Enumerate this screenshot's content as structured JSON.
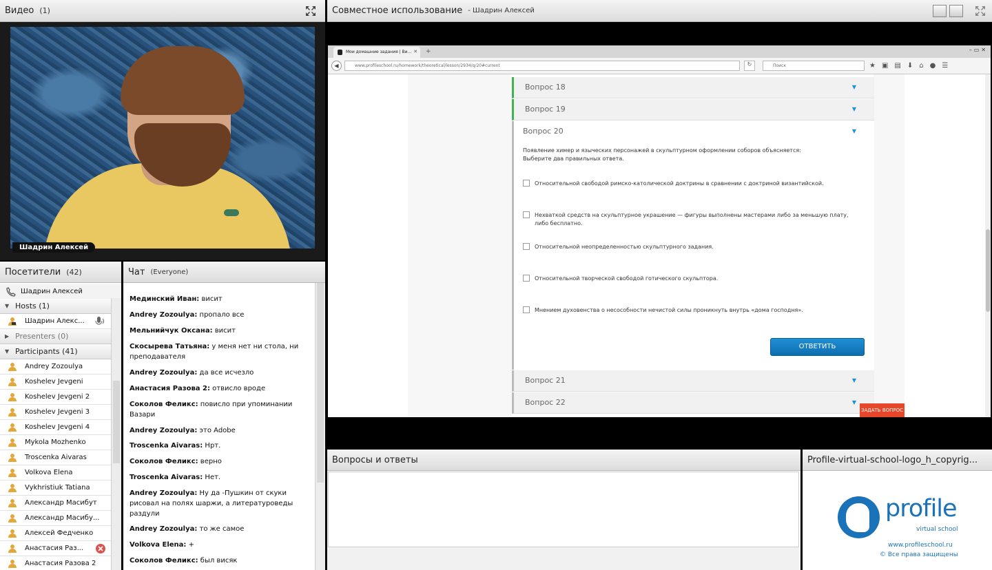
{
  "video": {
    "title": "Видео",
    "count": "(1)",
    "presenter_name": "Шадрин Алексей"
  },
  "share": {
    "title": "Совместное использование",
    "presenter": "- Шадрин Алексей",
    "browser": {
      "tab_title": "Мои домашние задания | Ви...",
      "tab_close": "✕",
      "new_tab": "+",
      "url": "www.profileschool.ru/homework/theoretical/lesson/2934/q/20#current",
      "search_placeholder": "Поиск"
    },
    "page": {
      "questions_before": [
        {
          "label": "Вопрос 18",
          "arrow": "▼"
        },
        {
          "label": "Вопрос 19",
          "arrow": "▼"
        }
      ],
      "open_question": {
        "label": "Вопрос 20",
        "arrow": "▼",
        "text_line1": "Появление химер и языческих персонажей в скульптурном оформлении соборов объясняется:",
        "text_line2": "Выберите два правильных ответа.",
        "options": [
          "Относительной свободой римско-католической доктрины в сравнении с доктриной византийской.",
          "Нехваткой средств на скульптурное украшение — фигуры выполнены мастерами либо за меньшую плату, либо бесплатно.",
          "Относительной неопределенностью скульптурного задания.",
          "Относительной творческой свободой готического скульптора.",
          "Мнением духовенства о несособности нечистой силы проникнуть внутрь «дома господня»."
        ],
        "answer_button": "ОТВЕТИТЬ"
      },
      "questions_after": [
        {
          "label": "Вопрос 21",
          "arrow": "▼"
        },
        {
          "label": "Вопрос 22",
          "arrow": "▼"
        }
      ],
      "ask_button": "ЗАДАТЬ ВОПРОС"
    }
  },
  "attendees": {
    "title": "Посетители",
    "count": "(42)",
    "me": "Шадрин Алексей",
    "hosts_label": "Hosts (1)",
    "host_name": "Шадрин Алекс...",
    "presenters_label": "Presenters (0)",
    "participants_label": "Participants (41)",
    "participants": [
      "Andrey Zozoulya",
      "Koshelev Jevgeni",
      "Koshelev Jevgeni 2",
      "Koshelev Jevgeni 3",
      "Koshelev Jevgeni 4",
      "Mykola Mozhenko",
      "Troscenka Aivaras",
      "Volkova Elena",
      "Vykhristiuk Tatiana",
      "Александр Масибут",
      "Александр Масибу...",
      "Алексей Федченко",
      "Анастасия Раз...",
      "Анастасия Разова 2"
    ]
  },
  "chat": {
    "title": "Чат",
    "audience": "(Everyone)",
    "messages": [
      {
        "author": "Мединский Иван:",
        "text": " висит"
      },
      {
        "author": "Andrey Zozoulya:",
        "text": " пропало все"
      },
      {
        "author": "Мельнийчук Оксана:",
        "text": " висит"
      },
      {
        "author": "Скосырева Татьяна:",
        "text": " у меня нет ни стола, ни преподавателя"
      },
      {
        "author": "Andrey Zozoulya:",
        "text": " да все исчезло"
      },
      {
        "author": "Анастасия Разова 2:",
        "text": " отвисло вроде"
      },
      {
        "author": "Соколов Феликс:",
        "text": " повисло при упоминании Вазари"
      },
      {
        "author": "Andrey Zozoulya:",
        "text": " это Adobe"
      },
      {
        "author": "Troscenka Aivaras:",
        "text": " Нрт."
      },
      {
        "author": "Соколов Феликс:",
        "text": " верно"
      },
      {
        "author": "Troscenka Aivaras:",
        "text": " Нет."
      },
      {
        "author": "Andrey Zozoulya:",
        "text": " Ну да -Пушкин от скуки рисовал на полях шаржи, а литературоведы раздули"
      },
      {
        "author": "Andrey Zozoulya:",
        "text": " то же самое"
      },
      {
        "author": "Volkova Elena:",
        "text": " +"
      },
      {
        "author": "Соколов Феликс:",
        "text": " был висяк"
      }
    ]
  },
  "qa": {
    "title": "Вопросы и ответы"
  },
  "logo_pod": {
    "title": "Profile-virtual-school-logo_h_copyrig...",
    "brand": "profile",
    "subtitle": "virtual school",
    "url": "www.profileschool.ru",
    "copyright": "© Все права защищены"
  },
  "colors": {
    "accent_blue": "#1a73b8",
    "answer_button": "#1f8fd6",
    "ask_button": "#e8462a",
    "answered_bar": "#3cb54a"
  }
}
